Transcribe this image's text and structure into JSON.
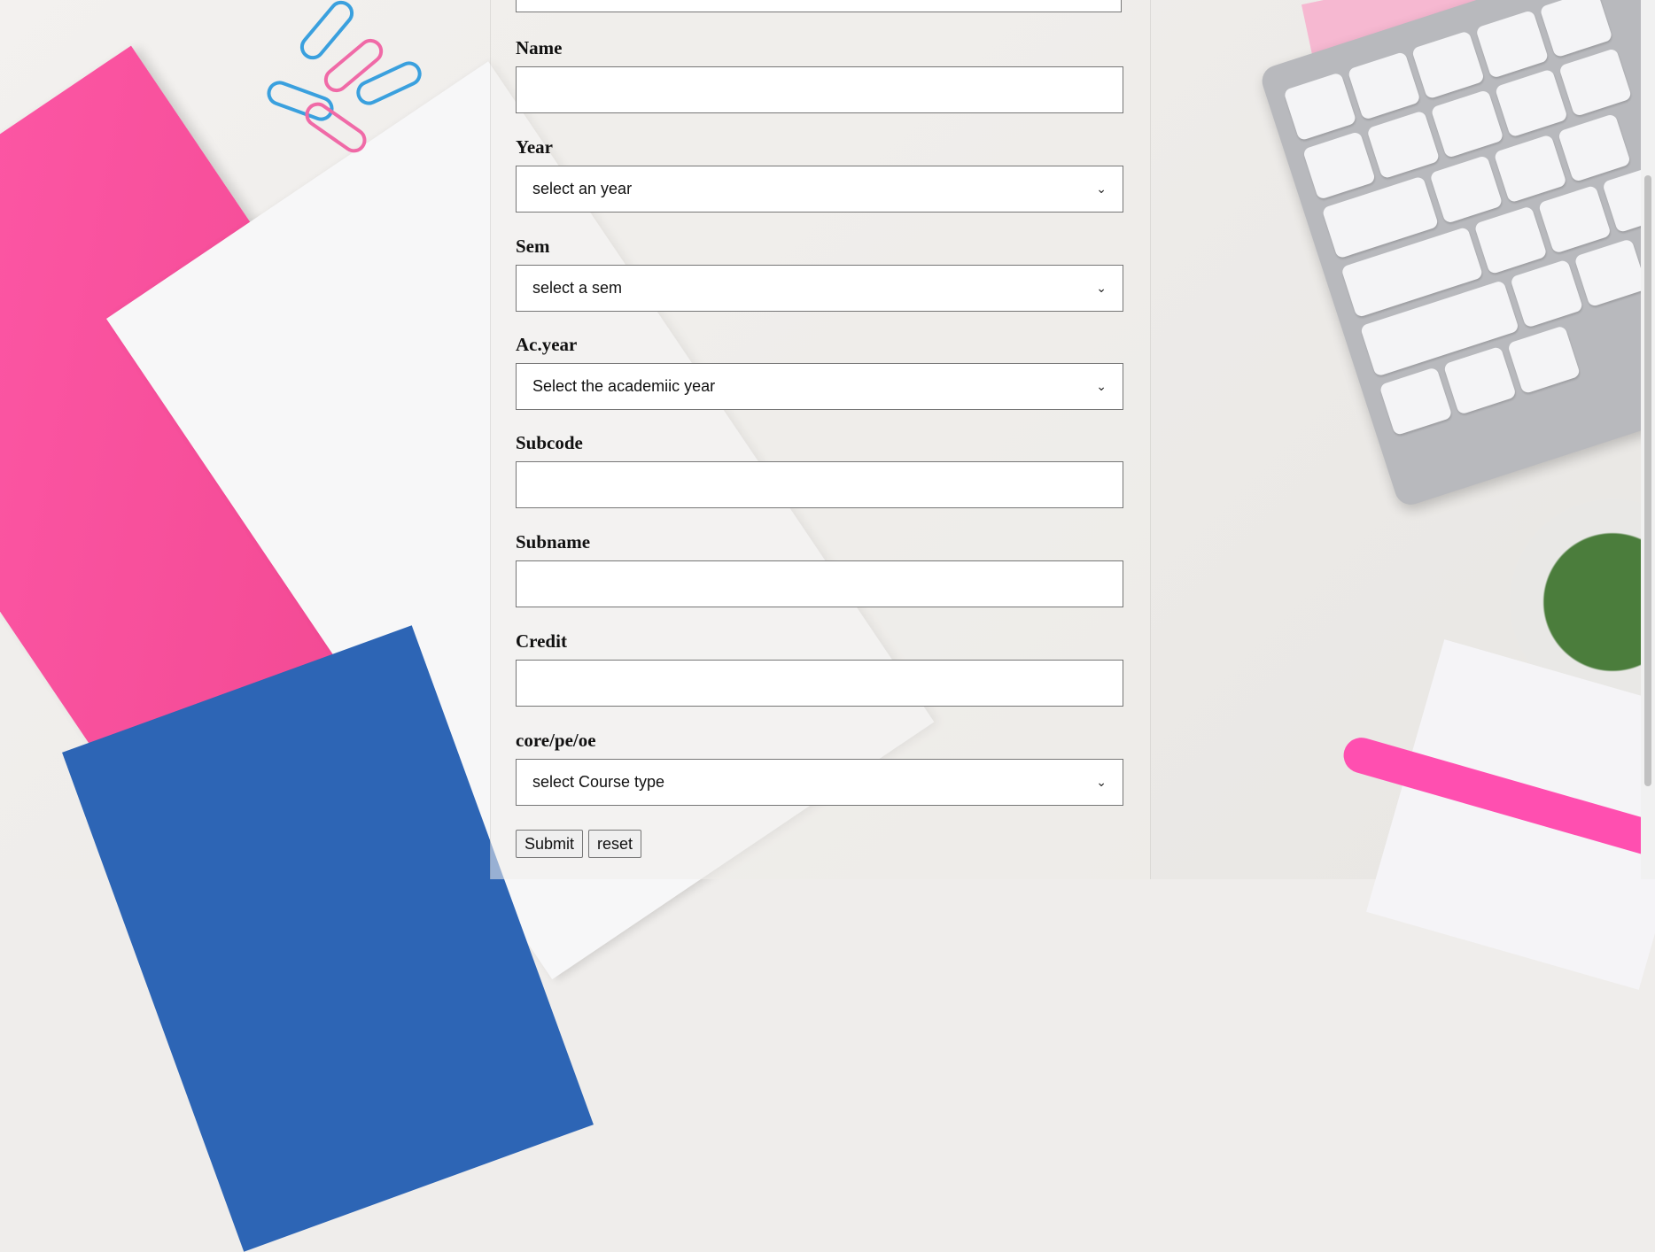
{
  "form": {
    "fields": [
      {
        "label": "Name",
        "type": "text",
        "value": ""
      },
      {
        "label": "Year",
        "type": "select",
        "value": "select an year"
      },
      {
        "label": "Sem",
        "type": "select",
        "value": "select a sem"
      },
      {
        "label": "Ac.year",
        "type": "select",
        "value": "Select the academiic year"
      },
      {
        "label": "Subcode",
        "type": "text",
        "value": ""
      },
      {
        "label": "Subname",
        "type": "text",
        "value": ""
      },
      {
        "label": "Credit",
        "type": "text",
        "value": ""
      },
      {
        "label": "core/pe/oe",
        "type": "select",
        "value": "select Course type"
      }
    ],
    "submit_label": "Submit",
    "reset_label": "reset"
  },
  "colors": {
    "page_background": "#efedeb",
    "pink_book": "#f0468f",
    "blue_book": "#2d65b5"
  }
}
